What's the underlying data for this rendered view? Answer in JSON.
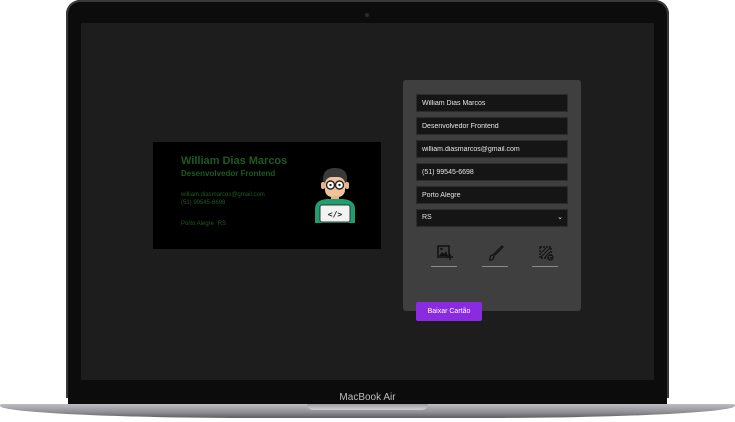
{
  "device": {
    "model_label": "MacBook Air"
  },
  "card": {
    "name": "William Dias Marcos",
    "role": "Desenvolvedor Frontend",
    "email": "william.diasmarcos@gmail.com",
    "phone": "(51) 99545-6698",
    "city": "Porto Alegre",
    "state": "RS",
    "text_color": "#1e5a20",
    "background_color": "#000000",
    "avatar_icon": "developer-avatar-icon"
  },
  "form": {
    "name_value": "William Dias Marcos",
    "role_value": "Desenvolvedor Frontend",
    "email_value": "william.diasmarcos@gmail.com",
    "phone_value": "(51) 99545-6698",
    "city_value": "Porto Alegre",
    "state_selected": "RS",
    "tools": [
      {
        "name": "add-image",
        "icon": "image-add-icon"
      },
      {
        "name": "text-color",
        "icon": "brush-icon"
      },
      {
        "name": "background-color",
        "icon": "background-fill-icon"
      }
    ],
    "download_label": "Baixar Cartão",
    "accent_color": "#8a2be2"
  }
}
